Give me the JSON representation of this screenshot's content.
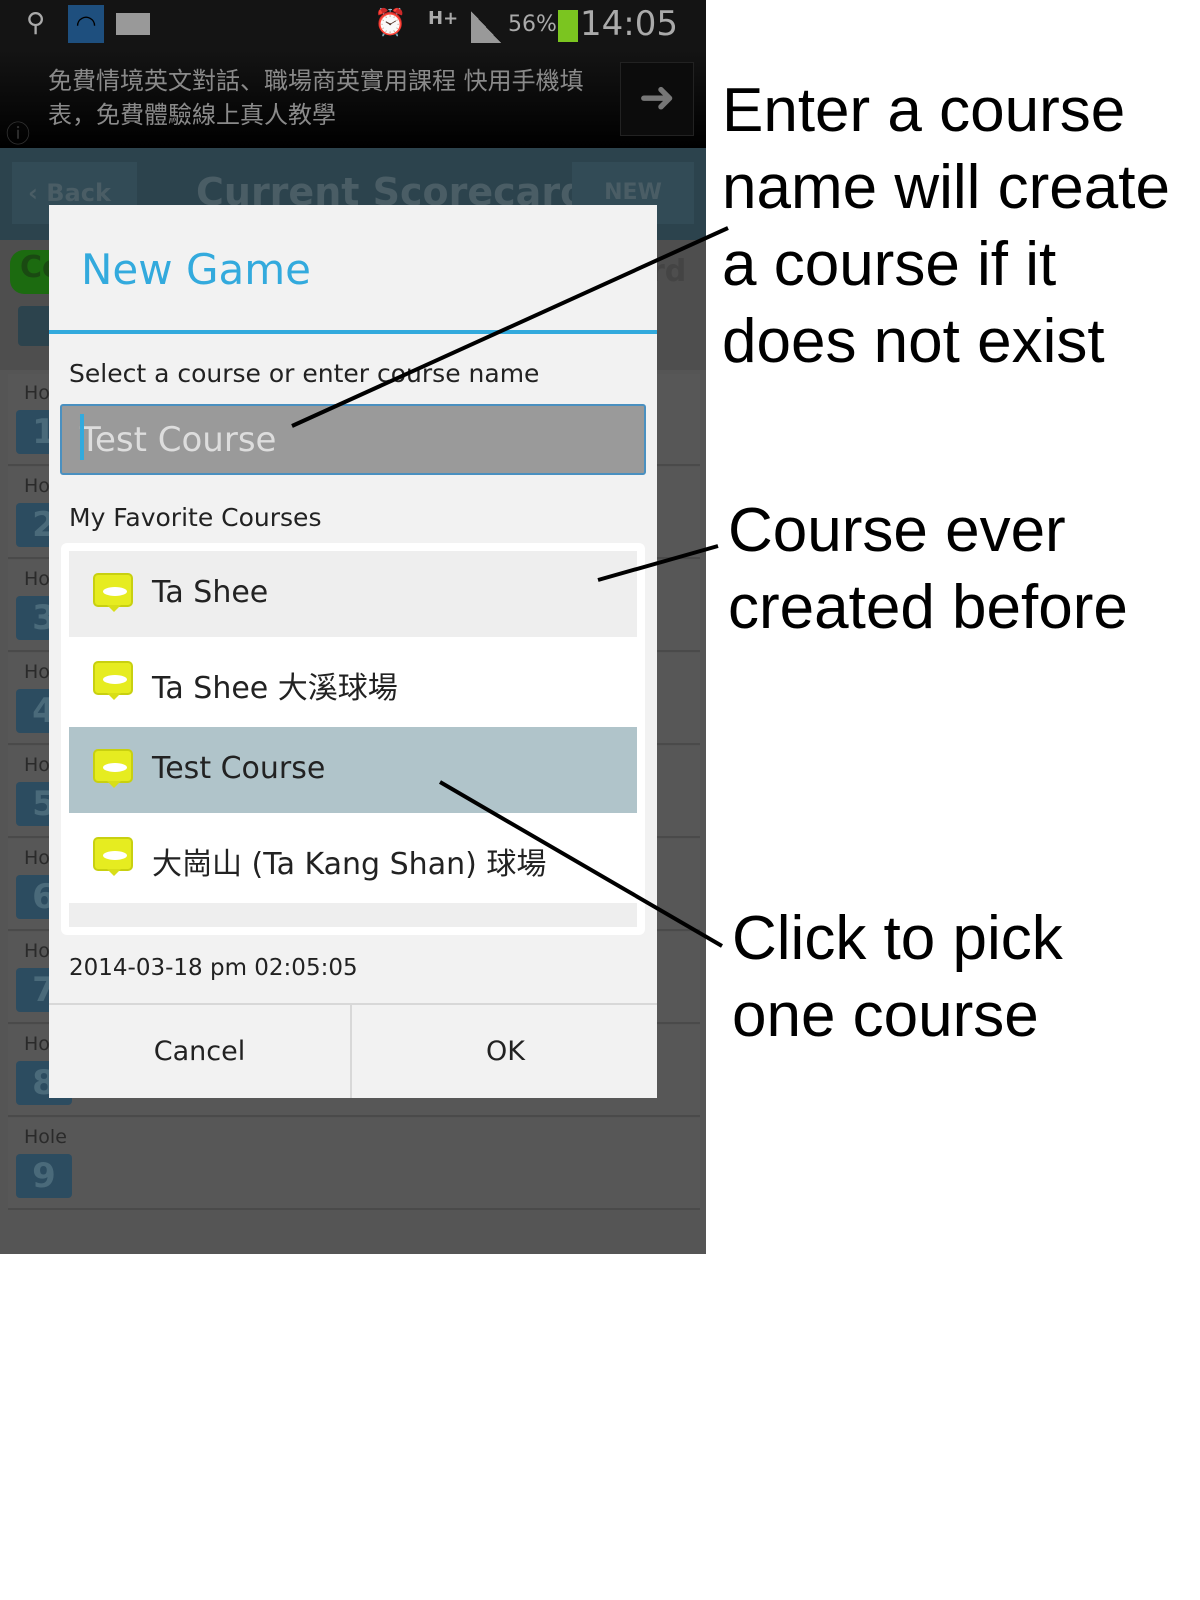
{
  "status_bar": {
    "battery": "56%",
    "time": "14:05",
    "network": "H+",
    "icons": [
      "usb-icon",
      "wifi-icon",
      "mail-icon",
      "alarm-icon",
      "signal-icon",
      "battery-charging-icon"
    ]
  },
  "ad": {
    "text": "免費情境英文對話、職場商英實用課程 快用手機填表，免費體驗線上真人教學",
    "arrow_icon": "arrow-right-icon"
  },
  "app_bar": {
    "back": "Back",
    "title": "Current Scorecard",
    "new": "NEW"
  },
  "background": {
    "holes": [
      {
        "label": "Ho",
        "num": "1"
      },
      {
        "label": "Ho",
        "num": "2"
      },
      {
        "label": "Ho",
        "num": "3"
      },
      {
        "label": "Ho",
        "num": "4"
      },
      {
        "label": "Ho",
        "num": "5"
      },
      {
        "label": "Ho",
        "num": "6"
      },
      {
        "label": "Ho",
        "num": "7"
      },
      {
        "label": "Ho",
        "num": "8"
      },
      {
        "label": "Hole",
        "num": "9"
      }
    ],
    "pill": "Co",
    "rd": "rd"
  },
  "dialog": {
    "title": "New Game",
    "prompt": "Select a course or enter course name",
    "input_value": "Test Course",
    "favorites_label": "My Favorite Courses",
    "courses": [
      {
        "name": "Ta Shee"
      },
      {
        "name": "Ta Shee 大溪球場"
      },
      {
        "name": "Test Course",
        "selected": true
      },
      {
        "name": "大崗山 (Ta Kang Shan) 球場"
      }
    ],
    "date": "2014-03-18 pm 02:05:05",
    "cancel": "Cancel",
    "ok": "OK"
  },
  "annotations": {
    "enter": "Enter a course name will create a course if it does not exist",
    "ever": "Course ever created before",
    "click": "Click to pick one course"
  },
  "colors": {
    "accent": "#33aadd",
    "selected_row": "#b0c4ca",
    "flag": "#e6ec20"
  }
}
